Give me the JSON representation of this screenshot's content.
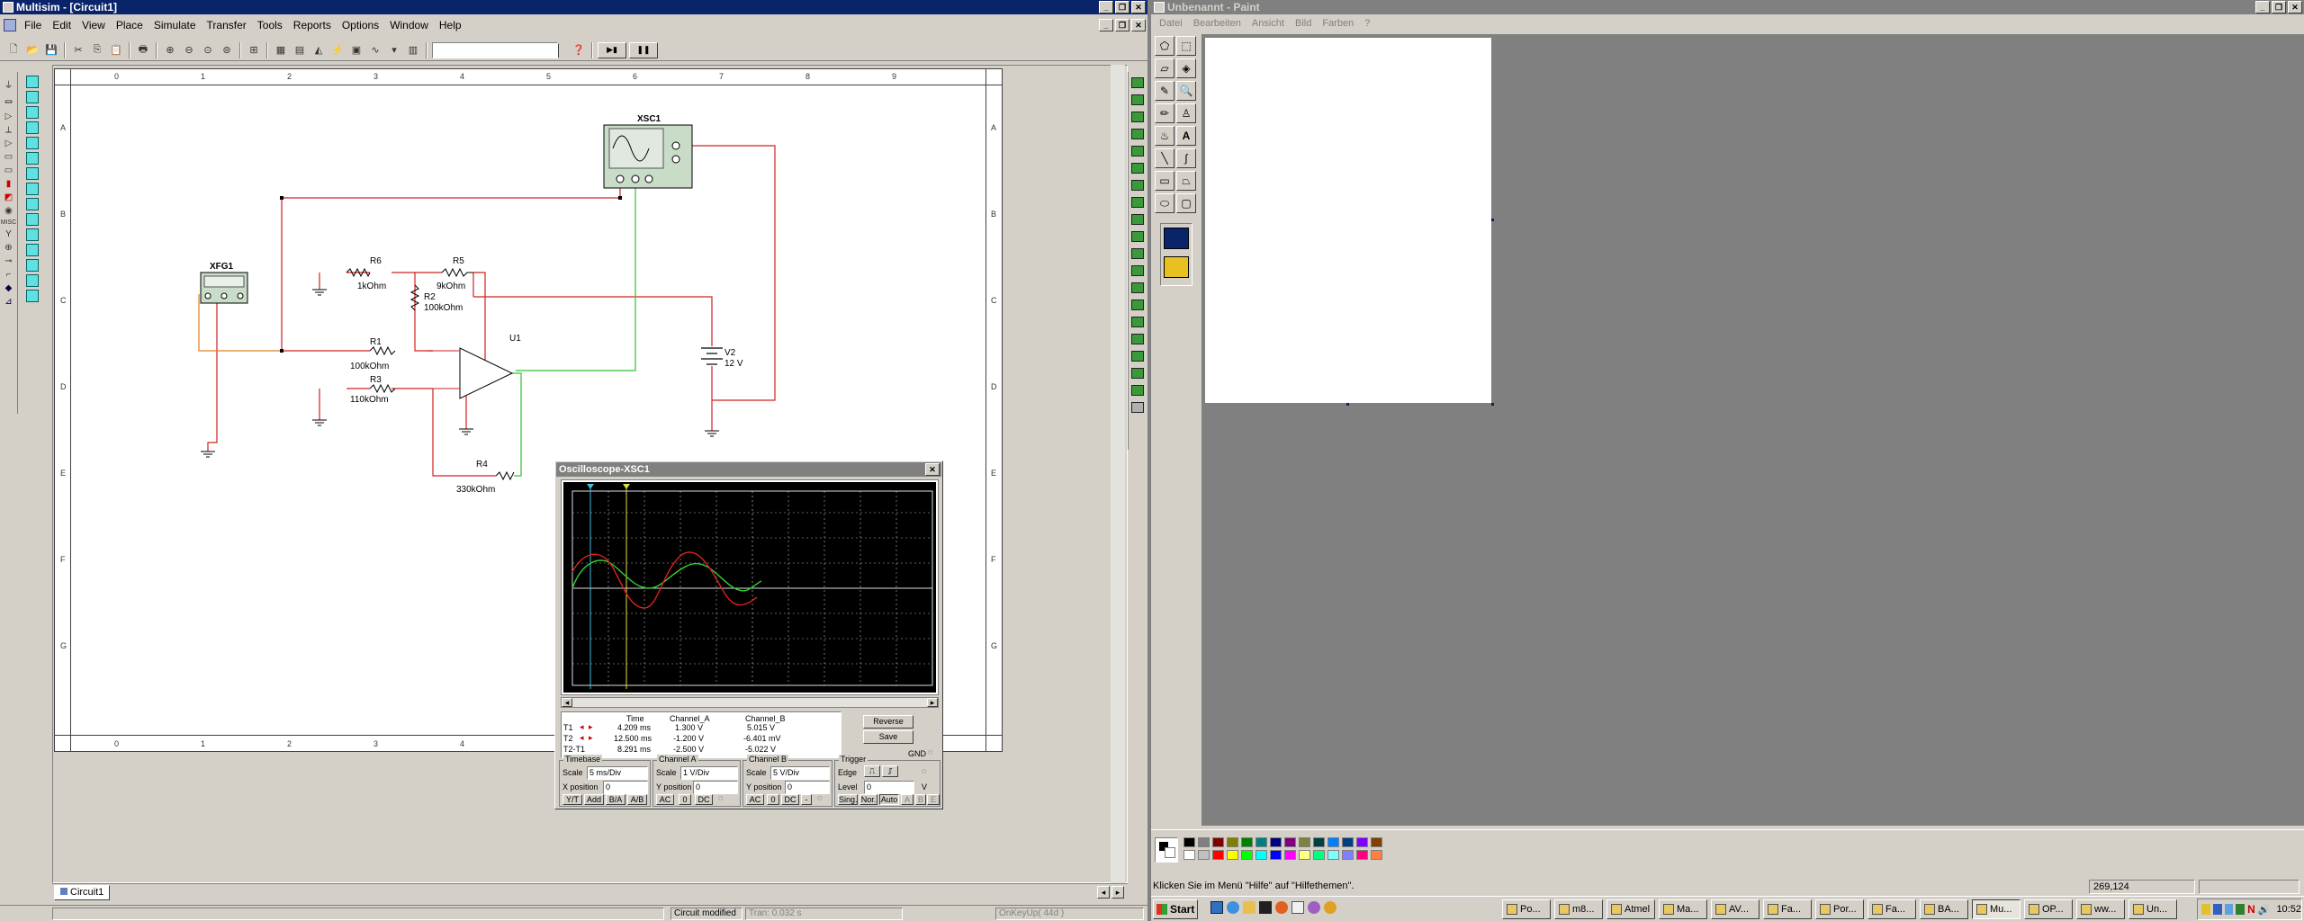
{
  "multisim": {
    "title": "Multisim - [Circuit1]",
    "menu": [
      "File",
      "Edit",
      "View",
      "Place",
      "Simulate",
      "Transfer",
      "Tools",
      "Reports",
      "Options",
      "Window",
      "Help"
    ],
    "window_controls": [
      "_",
      "❐",
      "✕"
    ],
    "doc_controls": [
      "_",
      "❐",
      "✕"
    ],
    "toolbar_icons": [
      "new-icon",
      "open-icon",
      "save-icon",
      "cut-icon",
      "copy-icon",
      "paste-icon",
      "print-icon",
      "zoom-in-icon",
      "zoom-out-icon",
      "zoom-area-icon",
      "zoom-fit-icon",
      "hierarchy-icon",
      "spreadsheet-icon",
      "database-icon",
      "component-wizard-icon",
      "postprocessor-icon",
      "grapher-icon",
      "analysis-icon",
      "help-icon"
    ],
    "in_use_dropdown": "",
    "ruler_cols": [
      "0",
      "1",
      "2",
      "3",
      "4",
      "5",
      "6",
      "7",
      "8",
      "9"
    ],
    "ruler_rows": [
      "A",
      "B",
      "C",
      "D",
      "E",
      "F",
      "G"
    ],
    "tab": "Circuit1",
    "status": {
      "left": "",
      "middle": "Circuit modified",
      "tran": "Tran: 0.032 s",
      "right": "OnKeyUp( 44d )"
    },
    "components": {
      "xfg": "XFG1",
      "xsc": "XSC1",
      "u1": "U1",
      "v2_name": "V2",
      "v2_value": "12  V",
      "r6_name": "R6",
      "r6_value": "1kOhm",
      "r5_name": "R5",
      "r5_value": "9kOhm",
      "r2_name": "R2",
      "r2_value": "100kOhm",
      "r1_name": "R1",
      "r1_value": "100kOhm",
      "r3_name": "R3",
      "r3_value": "110kOhm",
      "r4_name": "R4",
      "r4_value": "330kOhm"
    }
  },
  "oscilloscope": {
    "title": "Oscilloscope-XSC1",
    "table_headers": [
      "Time",
      "Channel_A",
      "Channel_B"
    ],
    "rows": [
      {
        "label": "T1",
        "time": "4.209 ms",
        "a": "1.300 V",
        "b": "5.015 V"
      },
      {
        "label": "T2",
        "time": "12.500 ms",
        "a": "-1.200 V",
        "b": "-6.401 mV"
      },
      {
        "label": "T2-T1",
        "time": "8.291 ms",
        "a": "-2.500 V",
        "b": "-5.022 V"
      }
    ],
    "reverse": "Reverse",
    "save": "Save",
    "gnd": "GND",
    "timebase": {
      "legend": "Timebase",
      "scale_label": "Scale",
      "scale": "5 ms/Div",
      "xpos_label": "X position",
      "xpos": "0",
      "modes": [
        "Y/T",
        "Add",
        "B/A",
        "A/B"
      ]
    },
    "channel_a": {
      "legend": "Channel A",
      "scale_label": "Scale",
      "scale": "1  V/Div",
      "ypos_label": "Y position",
      "ypos": "0",
      "modes": [
        "AC",
        "0",
        "DC"
      ]
    },
    "channel_b": {
      "legend": "Channel B",
      "scale_label": "Scale",
      "scale": "5  V/Div",
      "ypos_label": "Y position",
      "ypos": "0",
      "modes": [
        "AC",
        "0",
        "DC",
        "-"
      ]
    },
    "trigger": {
      "legend": "Trigger",
      "edge_label": "Edge",
      "level_label": "Level",
      "level": "0",
      "unit": "V",
      "modes": [
        "Sing.",
        "Nor.",
        "Auto"
      ]
    }
  },
  "paint": {
    "title": "Unbenannt - Paint",
    "menu": [
      "Datei",
      "Bearbeiten",
      "Ansicht",
      "Bild",
      "Farben",
      "?"
    ],
    "status_text": "Klicken Sie im Menü \"Hilfe\" auf \"Hilfethemen\".",
    "coords": "269,124",
    "tools": [
      "free-select-icon",
      "select-icon",
      "eraser-icon",
      "fill-icon",
      "color-picker-icon",
      "magnifier-icon",
      "pencil-icon",
      "brush-icon",
      "airbrush-icon",
      "text-icon",
      "line-icon",
      "curve-icon",
      "rectangle-icon",
      "polygon-icon",
      "ellipse-icon",
      "rounded-rect-icon"
    ],
    "palette": [
      "#000000",
      "#808080",
      "#800000",
      "#808000",
      "#008000",
      "#008080",
      "#000080",
      "#800080",
      "#808040",
      "#004040",
      "#0080ff",
      "#004080",
      "#8000ff",
      "#804000",
      "#ffffff",
      "#c0c0c0",
      "#ff0000",
      "#ffff00",
      "#00ff00",
      "#00ffff",
      "#0000ff",
      "#ff00ff",
      "#ffff80",
      "#00ff80",
      "#80ffff",
      "#8080ff",
      "#ff0080",
      "#ff8040"
    ]
  },
  "taskbar": {
    "start": "Start",
    "tasks": [
      "Po...",
      "m8...",
      "Atmel",
      "Ma...",
      "AV...",
      "Fa...",
      "Por...",
      "Fa...",
      "BA...",
      "Mu...",
      "OP...",
      "ww...",
      "Un..."
    ],
    "active_index": 9,
    "clock": "10:52"
  }
}
